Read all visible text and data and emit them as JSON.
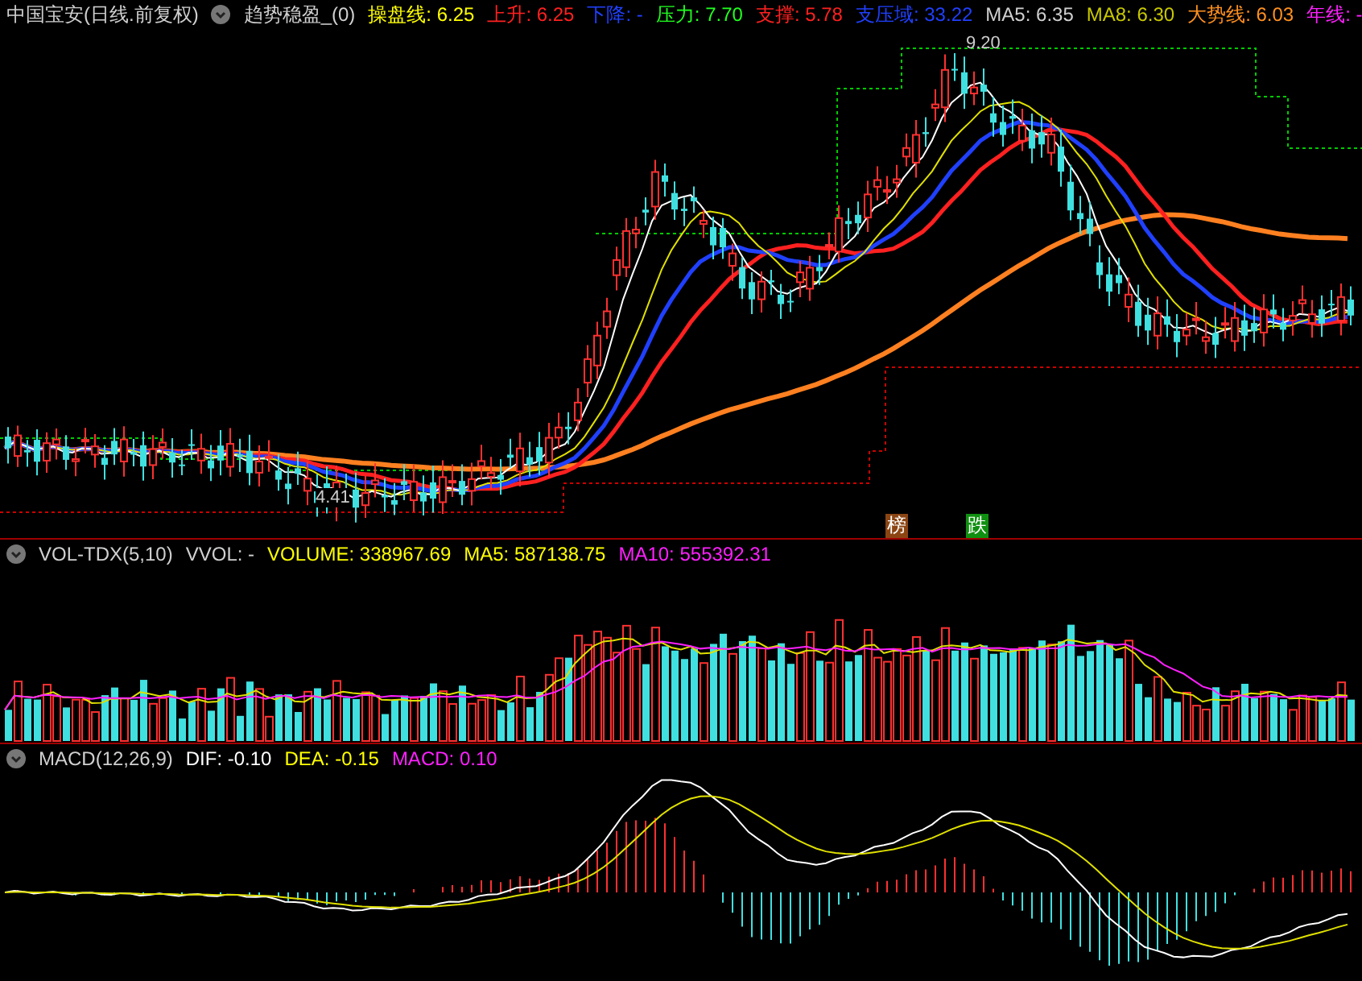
{
  "main_panel": {
    "title": "中国宝安(日线.前复权)",
    "indicator": "趋势稳盈_(0)",
    "values": [
      {
        "text": "操盘线: 6.25",
        "color": "#ffff00"
      },
      {
        "text": "上升: 6.25",
        "color": "#ff2020"
      },
      {
        "text": "下降: -",
        "color": "#2040ff"
      },
      {
        "text": "压力: 7.70",
        "color": "#20ff20"
      },
      {
        "text": "支撑: 5.78",
        "color": "#ff2020"
      },
      {
        "text": "支压域: 33.22",
        "color": "#2040ff"
      },
      {
        "text": "MA5: 6.35",
        "color": "#d0d0d0"
      },
      {
        "text": "MA8: 6.30",
        "color": "#c8c800"
      },
      {
        "text": "大势线: 6.03",
        "color": "#ff9020"
      },
      {
        "text": "年线: -",
        "color": "#ff20ff"
      }
    ],
    "high_label": "9.20",
    "low_label": "4.41",
    "badges": [
      {
        "text": "榜",
        "color": "#8b4513"
      },
      {
        "text": "跌",
        "color": "#109010"
      }
    ]
  },
  "volume_panel": {
    "title": "VOL-TDX(5,10)",
    "values": [
      {
        "text": "VVOL: -",
        "color": "#d0d0d0"
      },
      {
        "text": "VOLUME: 338967.69",
        "color": "#ffff00"
      },
      {
        "text": "MA5: 587138.75",
        "color": "#ffff00"
      },
      {
        "text": "MA10: 555392.31",
        "color": "#ff20ff"
      }
    ]
  },
  "macd_panel": {
    "title": "MACD(12,26,9)",
    "values": [
      {
        "text": "DIF: -0.10",
        "color": "#ffffff"
      },
      {
        "text": "DEA: -0.15",
        "color": "#ffff00"
      },
      {
        "text": "MACD: 0.10",
        "color": "#ff20ff"
      }
    ]
  }
}
